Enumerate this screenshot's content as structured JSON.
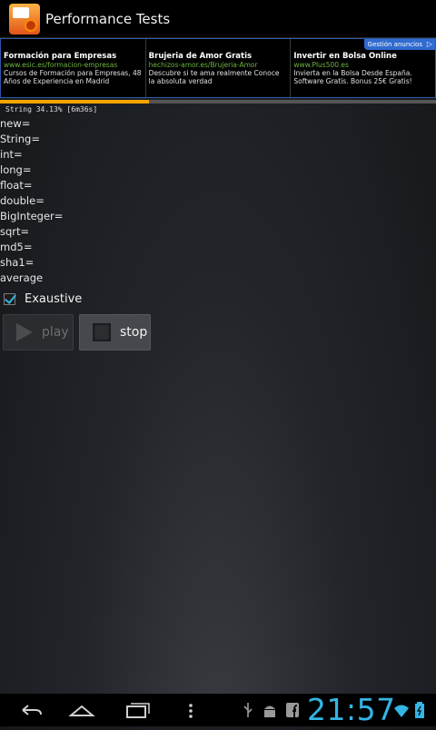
{
  "app": {
    "title": "Performance Tests",
    "icon": "app-icon"
  },
  "ad_banner": {
    "label": "Gestión anuncios",
    "ads": [
      {
        "title": "Formación para Empresas",
        "url": "www.esic.es/formacion-empresas",
        "description": "Cursos de Formación para Empresas, 48 Años de Experiencia en Madrid"
      },
      {
        "title": "Brujeria de Amor Gratis",
        "url": "hechizos-amor.es/Brujeria-Amor",
        "description": "Descubre si te ama realmente Conoce la absoluta verdad"
      },
      {
        "title": "Invertir en Bolsa Online",
        "url": "www.Plus500.es",
        "description": "Invierta en la Bolsa Desde España. Software Gratis. Bonus 25€ Gratis!"
      }
    ]
  },
  "progress": {
    "text": "String 34.13% [6m36s]",
    "fraction": 0.3413,
    "color": "#f5a600"
  },
  "results": [
    "new=",
    "String=",
    "int=",
    "long=",
    "float=",
    "double=",
    "BigInteger=",
    "sqrt=",
    "md5=",
    "sha1=",
    "average"
  ],
  "exaustive": {
    "label": "Exaustive",
    "checked": true
  },
  "buttons": {
    "play_label": "play",
    "stop_label": "stop"
  },
  "system_bar": {
    "time": "21:57",
    "accent": "#33b5e5"
  }
}
